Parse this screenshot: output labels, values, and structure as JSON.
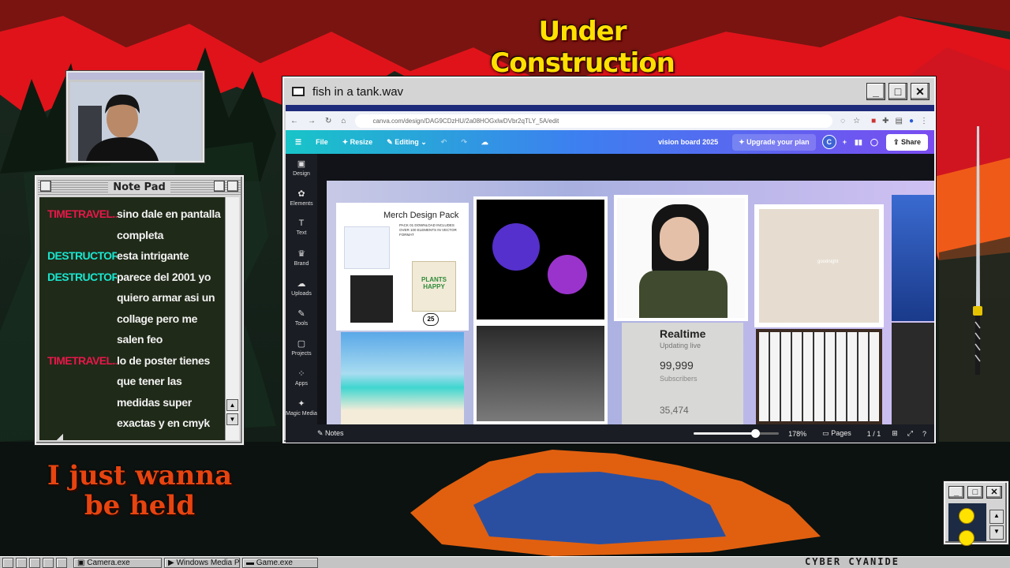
{
  "overlay": {
    "banner": "Under Construction",
    "tagline": "I just wanna be held",
    "brand": "CYBER CYANIDE"
  },
  "notepad": {
    "title": "Note Pad",
    "messages": [
      {
        "user": "TIMETRAVEL...",
        "text": "sino dale en pantalla completa",
        "color": "#e8174a"
      },
      {
        "user": "DESTRUCTOR...",
        "text": "esta intrigante",
        "color": "#19e6d0"
      },
      {
        "user": "DESTRUCTOR...",
        "text": "parece del 2001 yo quiero armar asi un collage pero me salen feo",
        "color": "#19e6d0"
      },
      {
        "user": "TIMETRAVEL...",
        "text": "lo de poster tienes que tener las medidas super exactas y en cmyk",
        "color": "#e8174a"
      }
    ]
  },
  "window": {
    "title": "fish in a tank.wav",
    "url": "canva.com/design/DAG9CDzHU/2a08HOGxlwDVbr2qTLY_5A/edit",
    "toolbar": {
      "file": "File",
      "resize": "Resize",
      "editing": "Editing",
      "doc_title": "vision board 2025",
      "upgrade": "Upgrade your plan",
      "avatar": "C",
      "share": "Share"
    },
    "sidebar": [
      "Design",
      "Elements",
      "Text",
      "Brand",
      "Uploads",
      "Tools",
      "Projects",
      "Apps",
      "Magic Media"
    ],
    "board": {
      "merch_title": "Merch Design Pack",
      "merch_sub": "PACK 01 DOWNLOAD INCLUDES OVER 100 ELEMENTS IN VECTOR FORMAT",
      "plants": "PLANTS HAPPY",
      "badge": "25",
      "realtime": "Realtime",
      "updating": "Updating live",
      "count": "99,999",
      "subscribers": "Subscribers",
      "count2": "35,474",
      "goodnight": "goodnight"
    },
    "bottom": {
      "notes": "Notes",
      "zoom": "178%",
      "zoom_level": 0.72,
      "pages": "Pages",
      "page_count": "1 / 1"
    }
  },
  "taskbar": {
    "items": [
      "Camera.exe",
      "Windows Media Pla",
      "Game.exe"
    ]
  },
  "colors": {
    "accent_red": "#e8174a",
    "accent_cyan": "#19e6d0",
    "canva_gradient_start": "#18c4c8",
    "canva_gradient_end": "#7a4cf0"
  }
}
